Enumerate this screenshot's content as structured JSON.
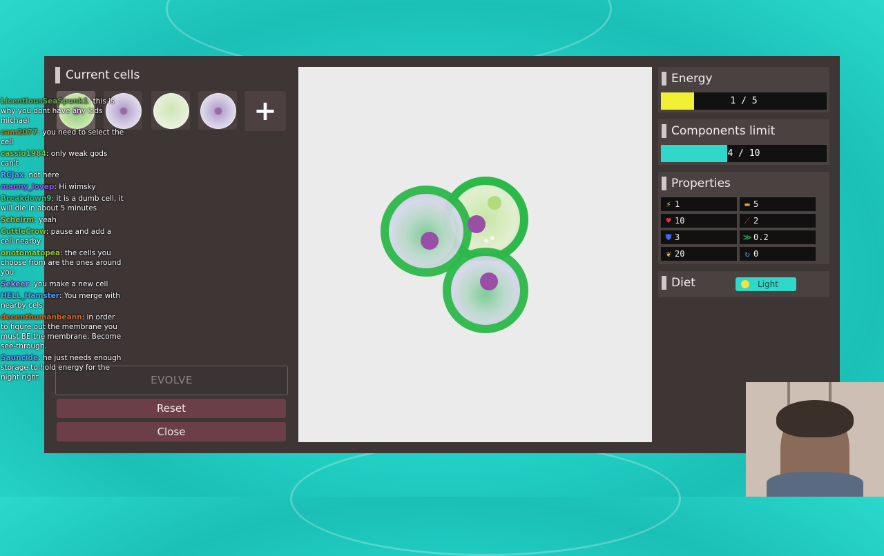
{
  "current_cells": {
    "title": "Current cells",
    "slots": [
      {
        "kind": "green-full",
        "selected": true
      },
      {
        "kind": "purple",
        "selected": false
      },
      {
        "kind": "green",
        "selected": false
      },
      {
        "kind": "purple",
        "selected": false
      }
    ],
    "add_glyph": "+"
  },
  "buttons": {
    "evolve": "EVOLVE",
    "reset": "Reset",
    "close": "Close"
  },
  "energy": {
    "title": "Energy",
    "value_text": "1 / 5",
    "fraction": 0.2,
    "color": "#f1f035"
  },
  "components_limit": {
    "title": "Components limit",
    "value_text": "4 / 10",
    "fraction": 0.4,
    "color": "#2fd8c9"
  },
  "properties": {
    "title": "Properties",
    "items": [
      {
        "icon": "lightning-icon",
        "glyph": "⚡",
        "color": "#f3e14a",
        "value": "1"
      },
      {
        "icon": "battery-icon",
        "glyph": "▬",
        "color": "#f3a63a",
        "value": "5"
      },
      {
        "icon": "heart-icon",
        "glyph": "♥",
        "color": "#e8323c",
        "value": "10"
      },
      {
        "icon": "sword-icon",
        "glyph": "⟋",
        "color": "#e8323c",
        "value": "2"
      },
      {
        "icon": "shield-icon",
        "glyph": "⛊",
        "color": "#3a6de8",
        "value": "3"
      },
      {
        "icon": "speed-icon",
        "glyph": "≫",
        "color": "#37d06a",
        "value": "0.2"
      },
      {
        "icon": "wheat-icon",
        "glyph": "❦",
        "color": "#f0b93a",
        "value": "20"
      },
      {
        "icon": "cycle-icon",
        "glyph": "↻",
        "color": "#3aa7e8",
        "value": "0"
      }
    ]
  },
  "diet": {
    "title": "Diet",
    "icon": "sun-icon",
    "value": "Light"
  },
  "chat": [
    {
      "user": "LicentiousSeaSpunk1",
      "color": "#6aa84f",
      "text": "this is why you dont have any kids michael"
    },
    {
      "user": "cam2077",
      "color": "#b8860b",
      "text": "you need to select the cell"
    },
    {
      "user": "cassio1984",
      "color": "#7fbf3f",
      "text": "only weak gods can't"
    },
    {
      "user": "RCJax",
      "color": "#5aa0ff",
      "text": "not here"
    },
    {
      "user": "manny_lovep",
      "color": "#9b59ff",
      "text": "Hi wimsky"
    },
    {
      "user": "Breakdown9",
      "color": "#3fbf7f",
      "text": "it is a dumb cell, it will die in about 5 minutes"
    },
    {
      "user": "Scheirm",
      "color": "#b8b830",
      "text": "yeah"
    },
    {
      "user": "CuttleCrow",
      "color": "#8fbf3f",
      "text": "pause and add a cell nearby"
    },
    {
      "user": "onotomatopea",
      "color": "#9acd32",
      "text": "the cells you choose from are the ones around you"
    },
    {
      "user": "Sekeer",
      "color": "#a78bfa",
      "text": "you make a new cell"
    },
    {
      "user": "HELL_Hamster",
      "color": "#4da6ff",
      "text": "You merge with nearby cels"
    },
    {
      "user": "decenthumanbeann",
      "color": "#d2691e",
      "text": "in order to figure out the membrane you must BE the membrane. Become see-through."
    },
    {
      "user": "Sauncide",
      "color": "#5aa0ff",
      "text": "he just needs enough storage to hold energy for the night right"
    }
  ]
}
